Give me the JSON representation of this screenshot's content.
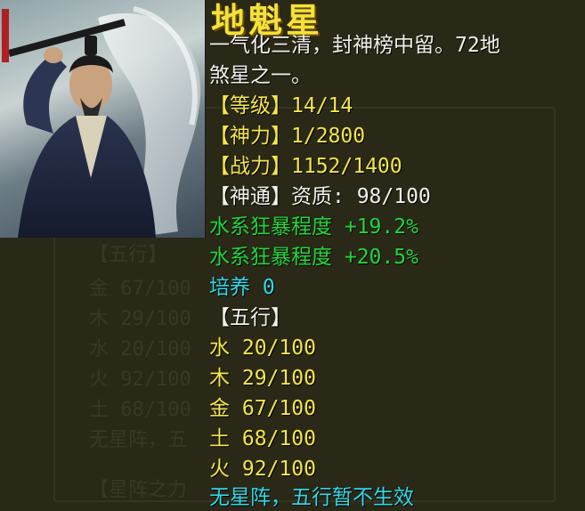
{
  "card": {
    "title": "地魁星",
    "description_line1": "一气化三清，封神榜中留。72地",
    "description_line2": "煞星之一。",
    "stats": [
      {
        "label": "【等级】",
        "value": "14/14"
      },
      {
        "label": "【神力】",
        "value": "1/2800"
      },
      {
        "label": "【战力】",
        "value": "1152/1400"
      }
    ],
    "shentong": {
      "label": "【神通】",
      "value": "资质: 98/100"
    },
    "bonuses": [
      "水系狂暴程度 +19.2%",
      "水系狂暴程度 +20.5%"
    ],
    "cultivate": "培养 0",
    "wuxing_header": "【五行】",
    "wuxing": [
      {
        "element": "水",
        "value": "20/100"
      },
      {
        "element": "木",
        "value": "29/100"
      },
      {
        "element": "金",
        "value": "67/100"
      },
      {
        "element": "土",
        "value": "68/100"
      },
      {
        "element": "火",
        "value": "92/100"
      }
    ],
    "formation_status": "无星阵，五行暂不生效"
  },
  "background_ghost": {
    "wuxing_header": "【五行】",
    "rows": [
      "金 67/100",
      "木 29/100",
      "水 20/100",
      "火 92/100",
      "土 68/100"
    ],
    "formation": "无星阵，五",
    "formation_header": "【星阵之力"
  },
  "colors": {
    "title": "#f2e23a",
    "stat": "#f3e64a",
    "bonus": "#22d63a",
    "cultivate": "#2fd8e8",
    "text": "#f2f0e8"
  }
}
